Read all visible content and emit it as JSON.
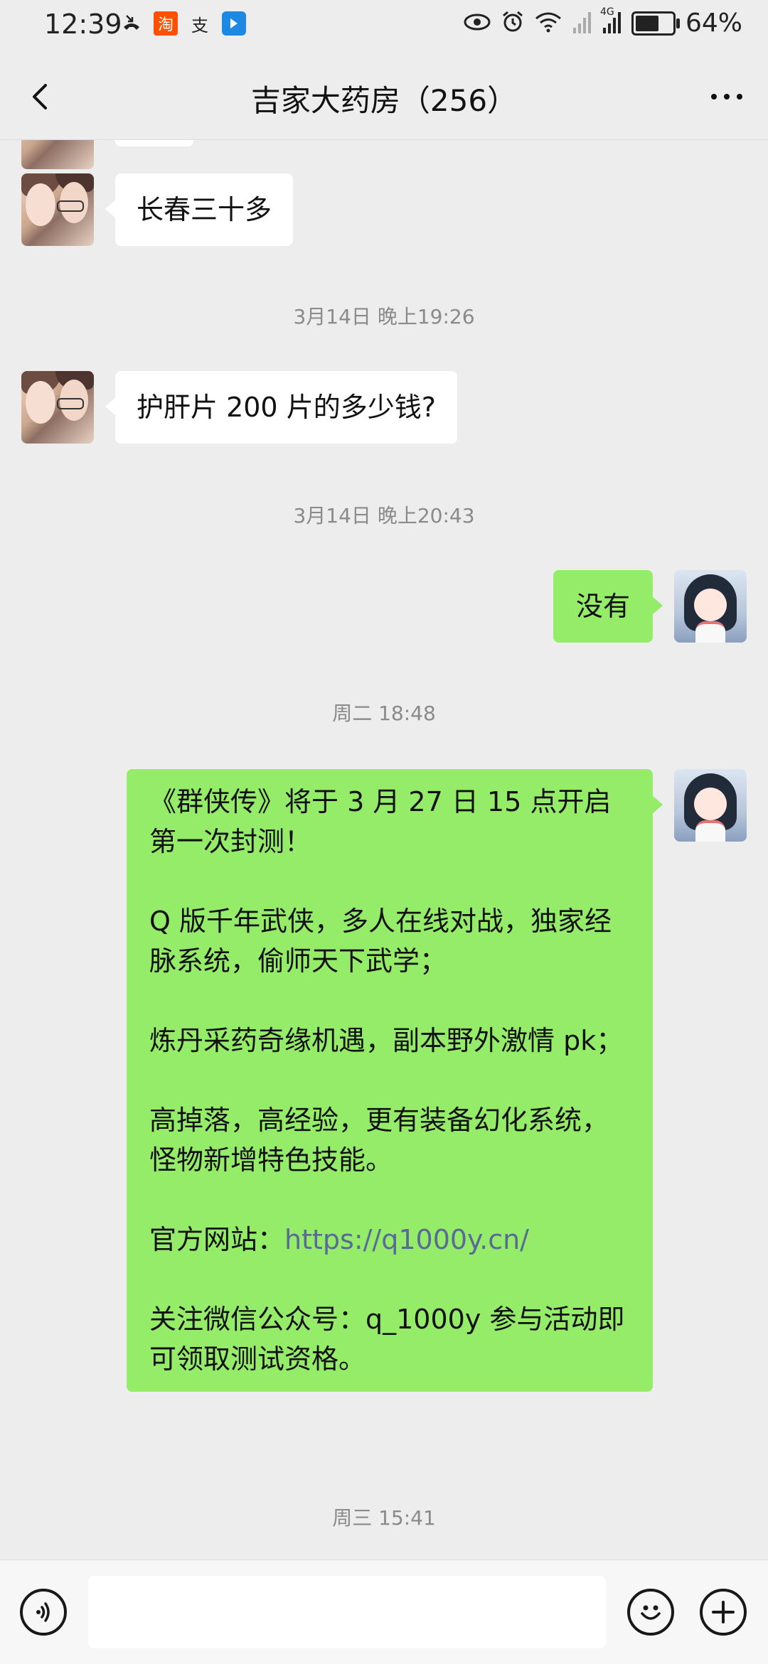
{
  "status_bar": {
    "time": "12:39",
    "battery": "64%",
    "battery_level": 0.64,
    "network_label": "4G",
    "left_icons": [
      "missed-call-icon",
      "taobao-app-icon",
      "alipay-icon",
      "blue-app-icon"
    ],
    "right_icons": [
      "eye-icon",
      "alarm-icon",
      "wifi-icon",
      "signal-icon",
      "signal-4g-icon",
      "battery-icon"
    ]
  },
  "header": {
    "title": "吉家大药房（256）",
    "back_icon": "chevron-left-icon",
    "more_icon": "more-horizontal-icon"
  },
  "messages": {
    "m1": {
      "side": "left",
      "text": "长春三十多"
    },
    "t1": "3月14日 晚上19:26",
    "m2": {
      "side": "left",
      "text": "护肝片 200 片的多少钱?"
    },
    "t2": "3月14日 晚上20:43",
    "m3": {
      "side": "right",
      "text": "没有"
    },
    "t3": "周二 18:48",
    "m4": {
      "side": "right",
      "p1": "《群侠传》将于 3 月 27 日 15 点开启第一次封测！",
      "p2": "Q 版千年武侠，多人在线对战，独家经脉系统，偷师天下武学；",
      "p3": "炼丹采药奇缘机遇，副本野外激情 pk；",
      "p4": "高掉落，高经验，更有装备幻化系统，怪物新增特色技能。",
      "p5_label": "官方网站：",
      "p5_link": "https://q1000y.cn/",
      "p6": "关注微信公众号：q_1000y 参与活动即可领取测试资格。"
    },
    "t4": "周三 15:41"
  },
  "input_bar": {
    "placeholder": "",
    "value": "",
    "voice_icon": "voice-icon",
    "emoji_icon": "emoji-icon",
    "plus_icon": "plus-icon"
  },
  "colors": {
    "background": "#ededed",
    "bubble_self": "#95ec69",
    "bubble_other": "#ffffff",
    "link": "#576b95",
    "timestamp": "#8a8a8a"
  }
}
